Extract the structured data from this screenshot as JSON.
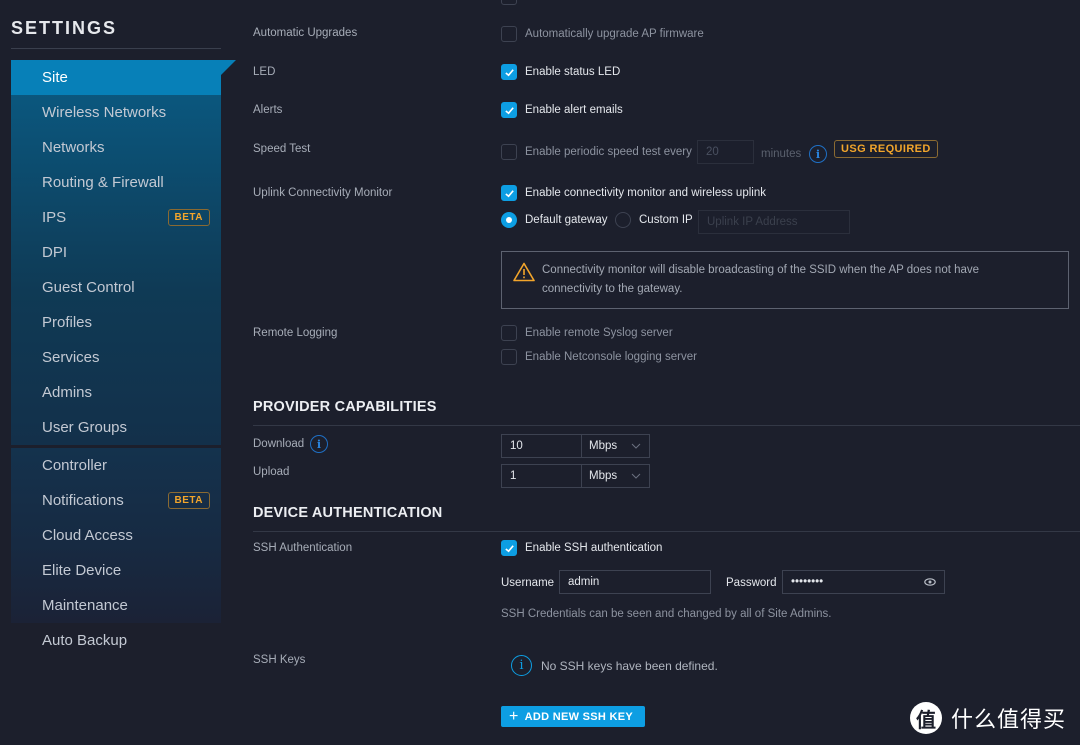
{
  "sidebar": {
    "title": "SETTINGS",
    "group1": [
      {
        "label": "Site",
        "active": true
      },
      {
        "label": "Wireless Networks"
      },
      {
        "label": "Networks"
      },
      {
        "label": "Routing & Firewall"
      },
      {
        "label": "IPS",
        "badge": "BETA"
      },
      {
        "label": "DPI"
      },
      {
        "label": "Guest Control"
      },
      {
        "label": "Profiles"
      },
      {
        "label": "Services"
      },
      {
        "label": "Admins"
      },
      {
        "label": "User Groups"
      }
    ],
    "group2": [
      {
        "label": "Controller"
      },
      {
        "label": "Notifications",
        "badge": "BETA"
      },
      {
        "label": "Cloud Access"
      },
      {
        "label": "Elite Device"
      },
      {
        "label": "Maintenance"
      },
      {
        "label": "Auto Backup"
      }
    ]
  },
  "site": {
    "automatic_upgrades": {
      "label": "Automatic Upgrades",
      "option": "Automatically upgrade AP firmware",
      "checked": false
    },
    "led": {
      "label": "LED",
      "option": "Enable status LED",
      "checked": true
    },
    "alerts": {
      "label": "Alerts",
      "option": "Enable alert emails",
      "checked": true
    },
    "speed_test": {
      "label": "Speed Test",
      "option": "Enable periodic speed test every",
      "checked": false,
      "interval_value": "20",
      "unit": "minutes",
      "badge": "USG REQUIRED"
    },
    "uplink": {
      "label": "Uplink Connectivity Monitor",
      "option": "Enable connectivity monitor and wireless uplink",
      "checked": true,
      "radio_default": "Default gateway",
      "radio_custom": "Custom IP",
      "selected": "Default gateway",
      "ip_placeholder": "Uplink IP Address",
      "warning_line1": "Connectivity monitor will disable broadcasting of the SSID when the AP does not have",
      "warning_line2": "connectivity to the gateway."
    },
    "remote_logging": {
      "label": "Remote Logging",
      "syslog": "Enable remote Syslog server",
      "syslog_checked": false,
      "netconsole": "Enable Netconsole logging server",
      "netconsole_checked": false
    }
  },
  "provider": {
    "title": "PROVIDER CAPABILITIES",
    "download_label": "Download",
    "download_value": "10",
    "download_unit": "Mbps",
    "upload_label": "Upload",
    "upload_value": "1",
    "upload_unit": "Mbps"
  },
  "device_auth": {
    "title": "DEVICE AUTHENTICATION",
    "ssh_label": "SSH Authentication",
    "ssh_option": "Enable SSH authentication",
    "ssh_checked": true,
    "username_label": "Username",
    "username_value": "admin",
    "password_label": "Password",
    "password_value": "••••••••",
    "credentials_hint": "SSH Credentials can be seen and changed by all of Site Admins.",
    "keys_label": "SSH Keys",
    "keys_empty": "No SSH keys have been defined.",
    "add_key_button": "ADD NEW SSH KEY"
  },
  "watermark": {
    "logo_char": "值",
    "text": "什么值得买"
  },
  "colors": {
    "accent": "#0d9ee3",
    "badge": "#f2a52b",
    "background": "#1c1f2c"
  }
}
